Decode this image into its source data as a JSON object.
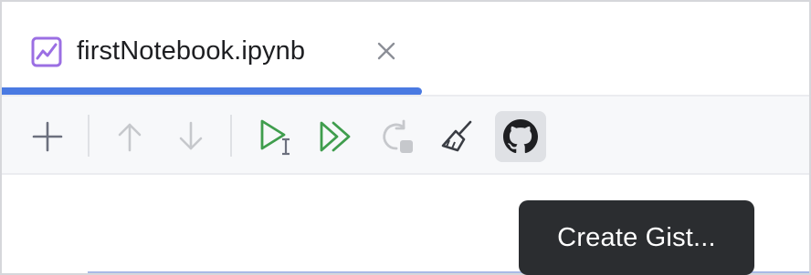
{
  "tab": {
    "title": "firstNotebook.ipynb",
    "icon": "notebook-chart-icon",
    "close_icon": "close-icon",
    "accent_color": "#4a7ae2",
    "icon_color": "#9b6fe3"
  },
  "toolbar": {
    "buttons": [
      {
        "name": "add-cell-button",
        "icon": "plus-icon",
        "enabled": true
      },
      {
        "name": "move-cell-up-button",
        "icon": "arrow-up-icon",
        "enabled": false
      },
      {
        "name": "move-cell-down-button",
        "icon": "arrow-down-icon",
        "enabled": false
      },
      {
        "name": "run-cell-button",
        "icon": "run-cursor-icon",
        "enabled": true
      },
      {
        "name": "run-all-button",
        "icon": "run-all-icon",
        "enabled": true
      },
      {
        "name": "restart-kernel-button",
        "icon": "restart-icon",
        "enabled": false
      },
      {
        "name": "clear-outputs-button",
        "icon": "broom-icon",
        "enabled": true
      },
      {
        "name": "create-gist-button",
        "icon": "github-icon",
        "enabled": true,
        "active": true
      }
    ],
    "run_color": "#3f9d4d",
    "disabled_color": "#c6c8cc",
    "enabled_color": "#6c707e"
  },
  "tooltip": {
    "text": "Create Gist..."
  }
}
